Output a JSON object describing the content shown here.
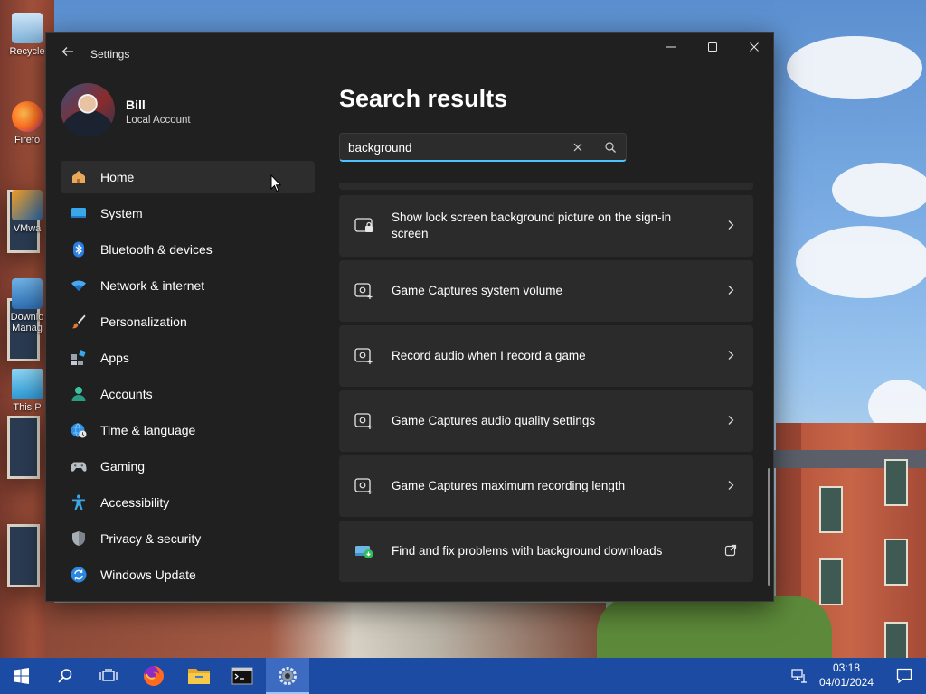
{
  "desktop": {
    "icons": [
      {
        "label": "Recycle",
        "icon": "recycle-bin-icon"
      },
      {
        "label": "Firefo",
        "icon": "firefox-icon"
      },
      {
        "label": "VMwa",
        "icon": "vmware-icon"
      },
      {
        "label": "Downlo Manag",
        "icon": "download-manager-icon"
      },
      {
        "label": "This P",
        "icon": "this-pc-icon"
      }
    ]
  },
  "window": {
    "title": "Settings",
    "controls": [
      "minimize",
      "maximize",
      "close"
    ]
  },
  "profile": {
    "name": "Bill",
    "account_type": "Local Account"
  },
  "sidebar": {
    "items": [
      {
        "label": "Home",
        "icon": "home-icon",
        "active": true
      },
      {
        "label": "System",
        "icon": "system-display-icon"
      },
      {
        "label": "Bluetooth & devices",
        "icon": "bluetooth-icon"
      },
      {
        "label": "Network & internet",
        "icon": "wifi-icon"
      },
      {
        "label": "Personalization",
        "icon": "paintbrush-icon"
      },
      {
        "label": "Apps",
        "icon": "apps-icon"
      },
      {
        "label": "Accounts",
        "icon": "person-icon"
      },
      {
        "label": "Time & language",
        "icon": "globe-clock-icon"
      },
      {
        "label": "Gaming",
        "icon": "gamepad-icon"
      },
      {
        "label": "Accessibility",
        "icon": "accessibility-icon"
      },
      {
        "label": "Privacy & security",
        "icon": "shield-icon"
      },
      {
        "label": "Windows Update",
        "icon": "update-icon"
      }
    ]
  },
  "main": {
    "heading": "Search results",
    "search": {
      "value": "background",
      "placeholder": ""
    },
    "results": [
      {
        "label": "Show lock screen background picture on the sign-in screen",
        "icon": "lock-screen-icon",
        "action": "chevron-right-icon"
      },
      {
        "label": "Game Captures system volume",
        "icon": "capture-icon",
        "action": "chevron-right-icon"
      },
      {
        "label": "Record audio when I record a game",
        "icon": "capture-icon",
        "action": "chevron-right-icon"
      },
      {
        "label": "Game Captures audio quality settings",
        "icon": "capture-icon",
        "action": "chevron-right-icon"
      },
      {
        "label": "Game Captures maximum recording length",
        "icon": "capture-icon",
        "action": "chevron-right-icon"
      },
      {
        "label": "Find and fix problems with background downloads",
        "icon": "troubleshoot-icon",
        "action": "external-link-icon"
      }
    ]
  },
  "taskbar": {
    "apps": [
      "start-icon",
      "search-icon",
      "task-view-icon",
      "firefox-icon",
      "file-explorer-icon",
      "terminal-icon",
      "settings-gear-icon"
    ],
    "clock_time": "03:18",
    "clock_date": "04/01/2024"
  },
  "colors": {
    "accent": "#4cc2ff",
    "window_bg": "#202020",
    "card_bg": "#2b2b2b",
    "taskbar_bg": "#1c4ba3"
  }
}
